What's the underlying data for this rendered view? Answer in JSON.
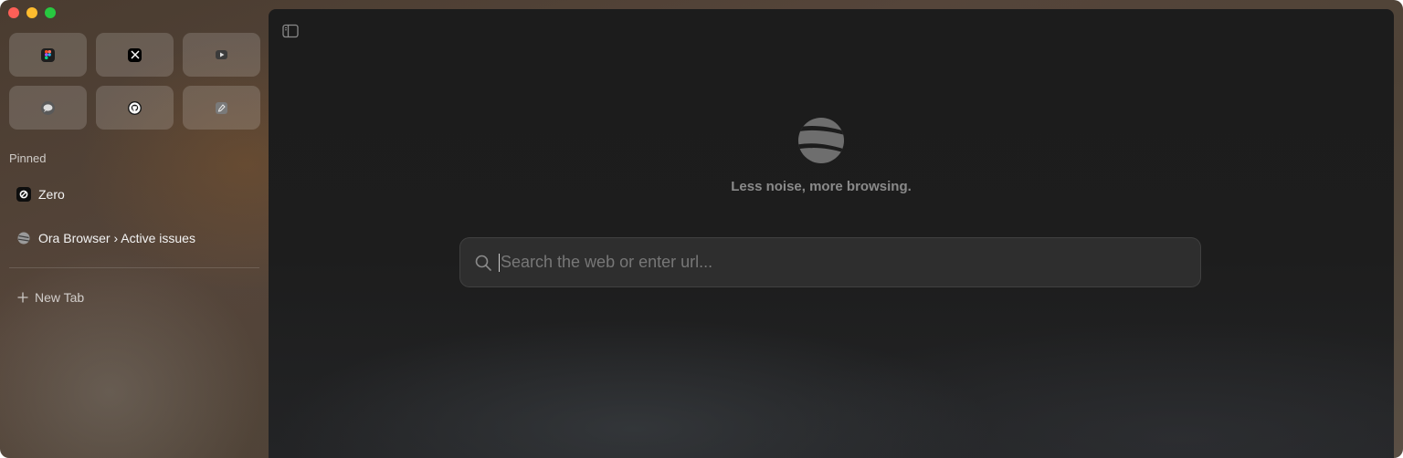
{
  "window": {
    "traffic_lights": [
      "close",
      "minimize",
      "maximize"
    ]
  },
  "sidebar": {
    "favorites": [
      {
        "icon": "figma-icon",
        "color": "#2a2a2a"
      },
      {
        "icon": "x-icon",
        "color": "#111111"
      },
      {
        "icon": "youtube-icon",
        "color": "#3a3a3a"
      },
      {
        "icon": "messages-icon",
        "color": "#555555"
      },
      {
        "icon": "github-icon",
        "color": "#222222"
      },
      {
        "icon": "notes-icon",
        "color": "#666666"
      }
    ],
    "pinned_label": "Pinned",
    "pinned": [
      {
        "label": "Zero",
        "icon": "zero-icon"
      },
      {
        "label": "Ora Browser › Active issues",
        "icon": "ora-icon"
      }
    ],
    "new_tab_label": "New Tab"
  },
  "main": {
    "tagline": "Less noise, more browsing.",
    "search": {
      "placeholder": "Search the web or enter url...",
      "value": ""
    }
  }
}
